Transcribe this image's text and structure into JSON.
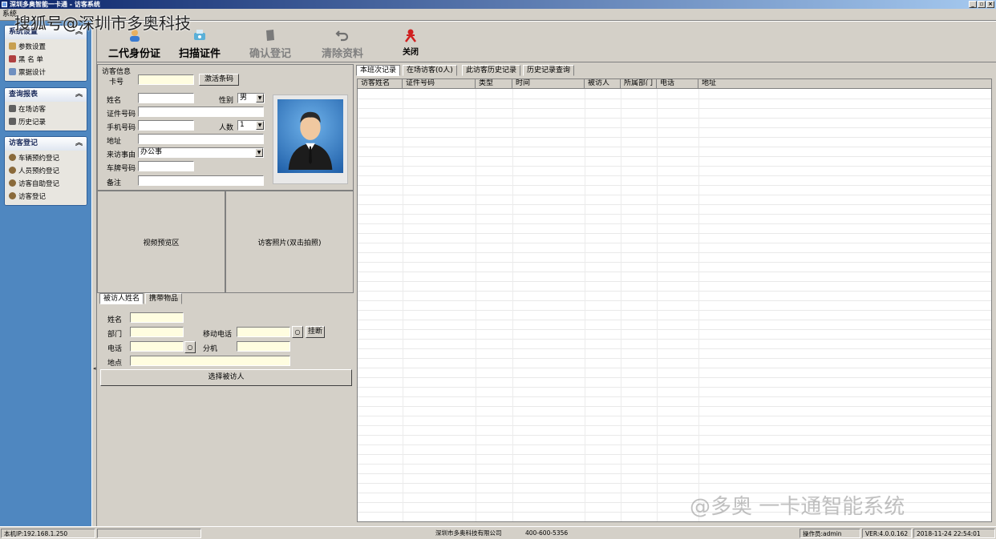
{
  "window": {
    "title": "深圳多奥智能一卡通 - 访客系统"
  },
  "menu": {
    "label": "系统"
  },
  "sidebar": {
    "panels": [
      {
        "title": "系统设置",
        "items": [
          {
            "label": "参数设置",
            "icon": "settings-icon"
          },
          {
            "label": "黑 名 单",
            "icon": "blacklist-icon"
          },
          {
            "label": "票据设计",
            "icon": "ticket-design-icon"
          }
        ]
      },
      {
        "title": "查询报表",
        "items": [
          {
            "label": "在场访客",
            "icon": "report-icon"
          },
          {
            "label": "历史记录",
            "icon": "report-icon"
          }
        ]
      },
      {
        "title": "访客登记",
        "items": [
          {
            "label": "车辆预约登记",
            "icon": "visitor-icon"
          },
          {
            "label": "人员预约登记",
            "icon": "visitor-icon"
          },
          {
            "label": "访客自助登记",
            "icon": "visitor-icon"
          },
          {
            "label": "访客登记",
            "icon": "visitor-icon"
          }
        ]
      }
    ]
  },
  "toolbar": {
    "id_card": "二代身份证",
    "scan": "扫描证件",
    "confirm": "确认登记",
    "clear": "清除资料",
    "close": "关闭"
  },
  "visitor": {
    "group_title": "访客信息",
    "card_label": "卡号",
    "card_value": "",
    "activate_button": "激活条码",
    "name_label": "姓名",
    "gender_label": "性别",
    "gender_value": "男",
    "id_label": "证件号码",
    "phone_label": "手机号码",
    "count_label": "人数",
    "count_value": "1",
    "address_label": "地址",
    "reason_label": "来访事由",
    "reason_value": "办公事",
    "plate_label": "车牌号码",
    "remark_label": "备注"
  },
  "media": {
    "video_preview": "视频预览区",
    "visitor_photo": "访客照片(双击拍照)"
  },
  "host": {
    "tabs": [
      "被访人姓名",
      "携带物品"
    ],
    "name_label": "姓名",
    "dept_label": "部门",
    "mobile_label": "移动电话",
    "hangup_button": "挂断",
    "tel_label": "电话",
    "ext_label": "分机",
    "location_label": "地点",
    "select_button": "选择被访人"
  },
  "records": {
    "tabs": [
      "本班次记录",
      "在场访客(0人)",
      "此访客历史记录",
      "历史记录查询"
    ],
    "columns": [
      "访客姓名",
      "证件号码",
      "类型",
      "时间",
      "被访人",
      "所属部门",
      "电话",
      "地址"
    ],
    "rows": []
  },
  "status": {
    "ip": "本机IP:192.168.1.250",
    "company": "深圳市多奥科技有限公司",
    "phone": "400-600-5356",
    "operator": "操作员:admin",
    "version": "VER:4.0.0.162",
    "datetime": "2018-11-24 22:54:01"
  },
  "watermarks": {
    "top_left": "搜狐号@深圳市多奥科技",
    "bottom_right": "@多奥 一卡通智能系统"
  }
}
